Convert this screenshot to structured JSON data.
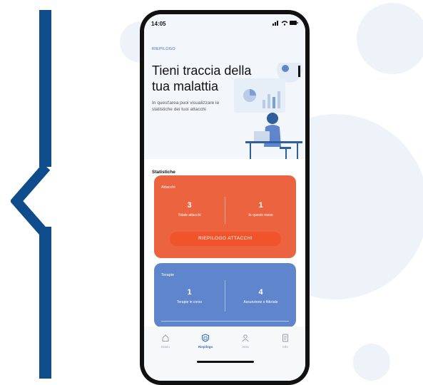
{
  "status_bar": {
    "time": "14:05"
  },
  "header": {
    "eyebrow": "RIEPILOGO",
    "title": "Tieni traccia della tua malattia",
    "subtitle": "In quest'area puoi visualizzare le statistiche dei tuoi attacchi"
  },
  "statistics": {
    "heading": "Statistiche",
    "attacks_card": {
      "label": "Attacchi",
      "stats": [
        {
          "value": "3",
          "label": "Totale attacchi"
        },
        {
          "value": "1",
          "label": "In questo mese"
        }
      ],
      "button_label": "RIEPILOGO ATTACCHI",
      "color": "#ec6340"
    },
    "therapies_card": {
      "label": "Terapie",
      "stats": [
        {
          "value": "1",
          "label": "Terapie in corso"
        },
        {
          "value": "4",
          "label": "Assunzione e fittiziale"
        }
      ],
      "color": "#5f86cc"
    }
  },
  "tab_bar": {
    "tabs": [
      {
        "label": "Diario",
        "icon": "home-icon",
        "active": false
      },
      {
        "label": "Riepilogo",
        "icon": "shield-icon",
        "active": true
      },
      {
        "label": "Area",
        "icon": "person-icon",
        "active": false
      },
      {
        "label": "Info",
        "icon": "document-icon",
        "active": false
      }
    ]
  },
  "colors": {
    "accent": "#2f6fc1",
    "brand_dark": "#0f4c8c"
  }
}
